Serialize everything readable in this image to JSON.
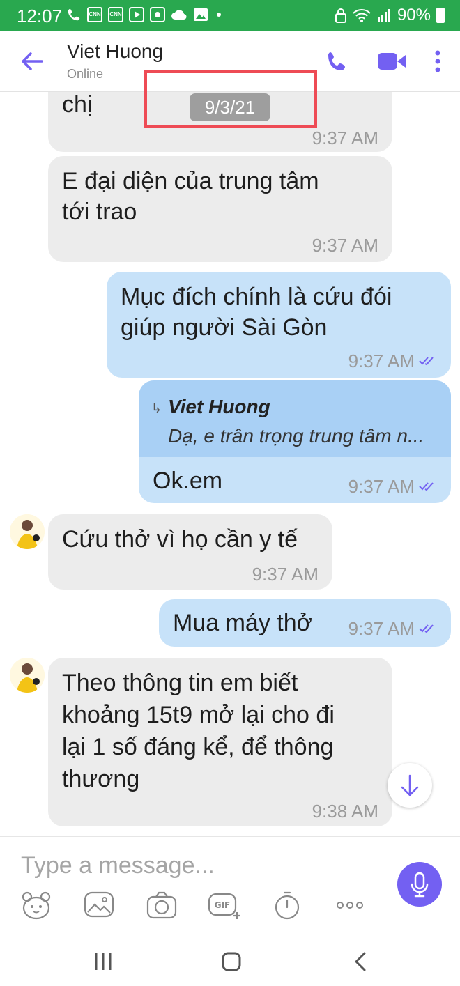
{
  "status_bar": {
    "time": "12:07",
    "battery": "90%",
    "notif_icons": [
      "CNN",
      "CNN"
    ]
  },
  "header": {
    "contact_name": "Viet Huong",
    "contact_status": "Online"
  },
  "date_chip": "9/3/21",
  "messages": [
    {
      "dir": "in",
      "lines": [
        "chị"
      ],
      "time": "9:37 AM"
    },
    {
      "dir": "in",
      "lines": [
        "E đại diện của trung tâm",
        "tới trao"
      ],
      "time": "9:37 AM"
    },
    {
      "dir": "out",
      "lines": [
        "Mục đích chính là cứu đói",
        "giúp người Sài Gòn"
      ],
      "time": "9:37 AM"
    },
    {
      "dir": "out",
      "reply_to": {
        "name": "Viet Huong",
        "text": "Dạ, e trân trọng trung tâm n..."
      },
      "lines": [
        "Ok.em"
      ],
      "time": "9:37 AM"
    },
    {
      "dir": "in",
      "lines": [
        "Cứu thở vì họ cần y tế"
      ],
      "time": "9:37 AM"
    },
    {
      "dir": "out",
      "lines": [
        "Mua máy thở"
      ],
      "time": "9:37 AM"
    },
    {
      "dir": "in",
      "lines": [
        "Theo thông tin em biết",
        "khoảng 15t9 mở lại cho đi",
        "lại 1 số đáng kể, để thông",
        "thương"
      ],
      "time": "9:38 AM"
    }
  ],
  "composer": {
    "placeholder": "Type a message..."
  },
  "toolbar_icons": [
    "sticker-icon",
    "gallery-icon",
    "camera-icon",
    "gif-icon",
    "timer-icon",
    "more-icon"
  ],
  "colors": {
    "status_bar": "#29a84f",
    "accent": "#7360f2",
    "incoming": "#ececec",
    "outgoing": "#c7e2f9",
    "highlight": "#ee4b55"
  }
}
